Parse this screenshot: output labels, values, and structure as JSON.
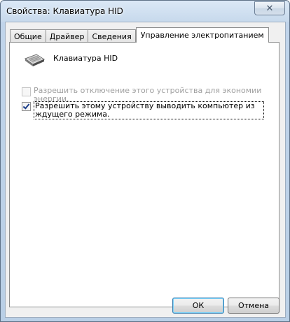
{
  "window": {
    "title": "Свойства: Клавиатура HID",
    "close_symbol": "✕"
  },
  "tabs": [
    {
      "label": "Общие"
    },
    {
      "label": "Драйвер"
    },
    {
      "label": "Сведения"
    },
    {
      "label": "Управление электропитанием"
    }
  ],
  "device": {
    "name": "Клавиатура HID",
    "icon": "keyboard-icon"
  },
  "options": {
    "allow_turn_off": {
      "label": "Разрешить отключение этого устройства для экономии энергии.",
      "checked": false,
      "enabled": false
    },
    "allow_wake": {
      "label": "Разрешить этому устройству выводить компьютер из ждущего режима.",
      "checked": true,
      "enabled": true
    }
  },
  "buttons": {
    "ok": "ОК",
    "cancel": "Отмена"
  }
}
